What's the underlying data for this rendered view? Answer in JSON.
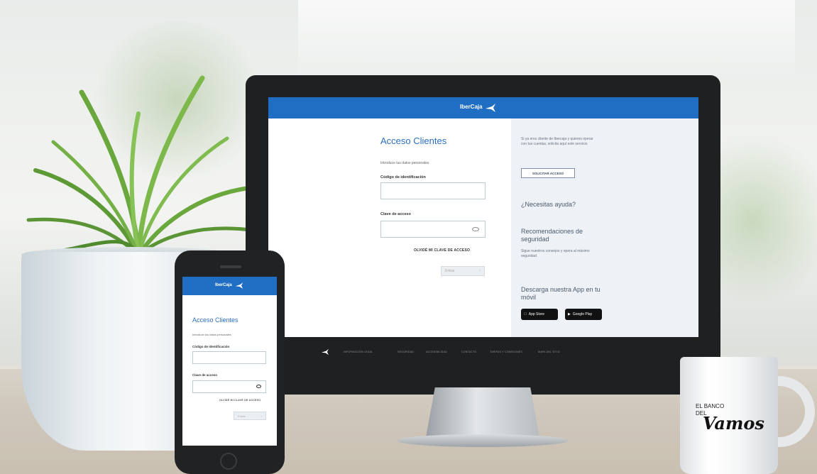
{
  "monitor": {
    "brand": "IberCaja",
    "login": {
      "title": "Acceso Clientes",
      "intro": "Introduce tus datos personales",
      "id_label": "Código de identificación",
      "id_value": "",
      "password_label": "Clave de acceso",
      "password_value": "",
      "forgot_link": "OLVIDÉ MI CLAVE DE ACCESO",
      "submit_label": "Entrar"
    },
    "side": {
      "intro": "Si ya eres cliente de Ibercaja y quieres operar con tus cuentas, solicita aquí este servicio",
      "request_button": "SOLICITAR ACCESO",
      "help_heading": "¿Necesitas ayuda?",
      "security_heading": "Recomendaciones de seguridad",
      "security_text": "Sigue nuestros consejos y opera al máximo seguridad",
      "app_heading": "Descarga nuestra App en tu móvil",
      "app_store": "App Store",
      "google_play": "Google Play"
    },
    "footer_links": [
      "INFORMACIÓN LEGAL",
      "SEGURIDAD",
      "ACCESIBILIDAD",
      "CONTACTO",
      "TARIFAS Y COMISIONES",
      "MAPA DEL SITIO"
    ]
  },
  "phone": {
    "brand": "IberCaja",
    "title": "Acceso Clientes",
    "intro": "Introduce tus datos personales",
    "id_label": "Código de identificación",
    "password_label": "Clave de acceso",
    "forgot_link": "OLVIDÉ MI CLAVE DE ACCESO",
    "submit_label": "Entrar"
  },
  "mug": {
    "line1": "EL BANCO",
    "line2": "DEL",
    "script": "Vamos"
  },
  "colors": {
    "brand_blue": "#1f6ec4",
    "title_blue": "#2d6fbf",
    "side_panel": "#eef2f7"
  },
  "icons": [
    "ibercaja-logo-icon",
    "eye-icon",
    "apple-icon",
    "play-icon",
    "home-button-icon"
  ]
}
